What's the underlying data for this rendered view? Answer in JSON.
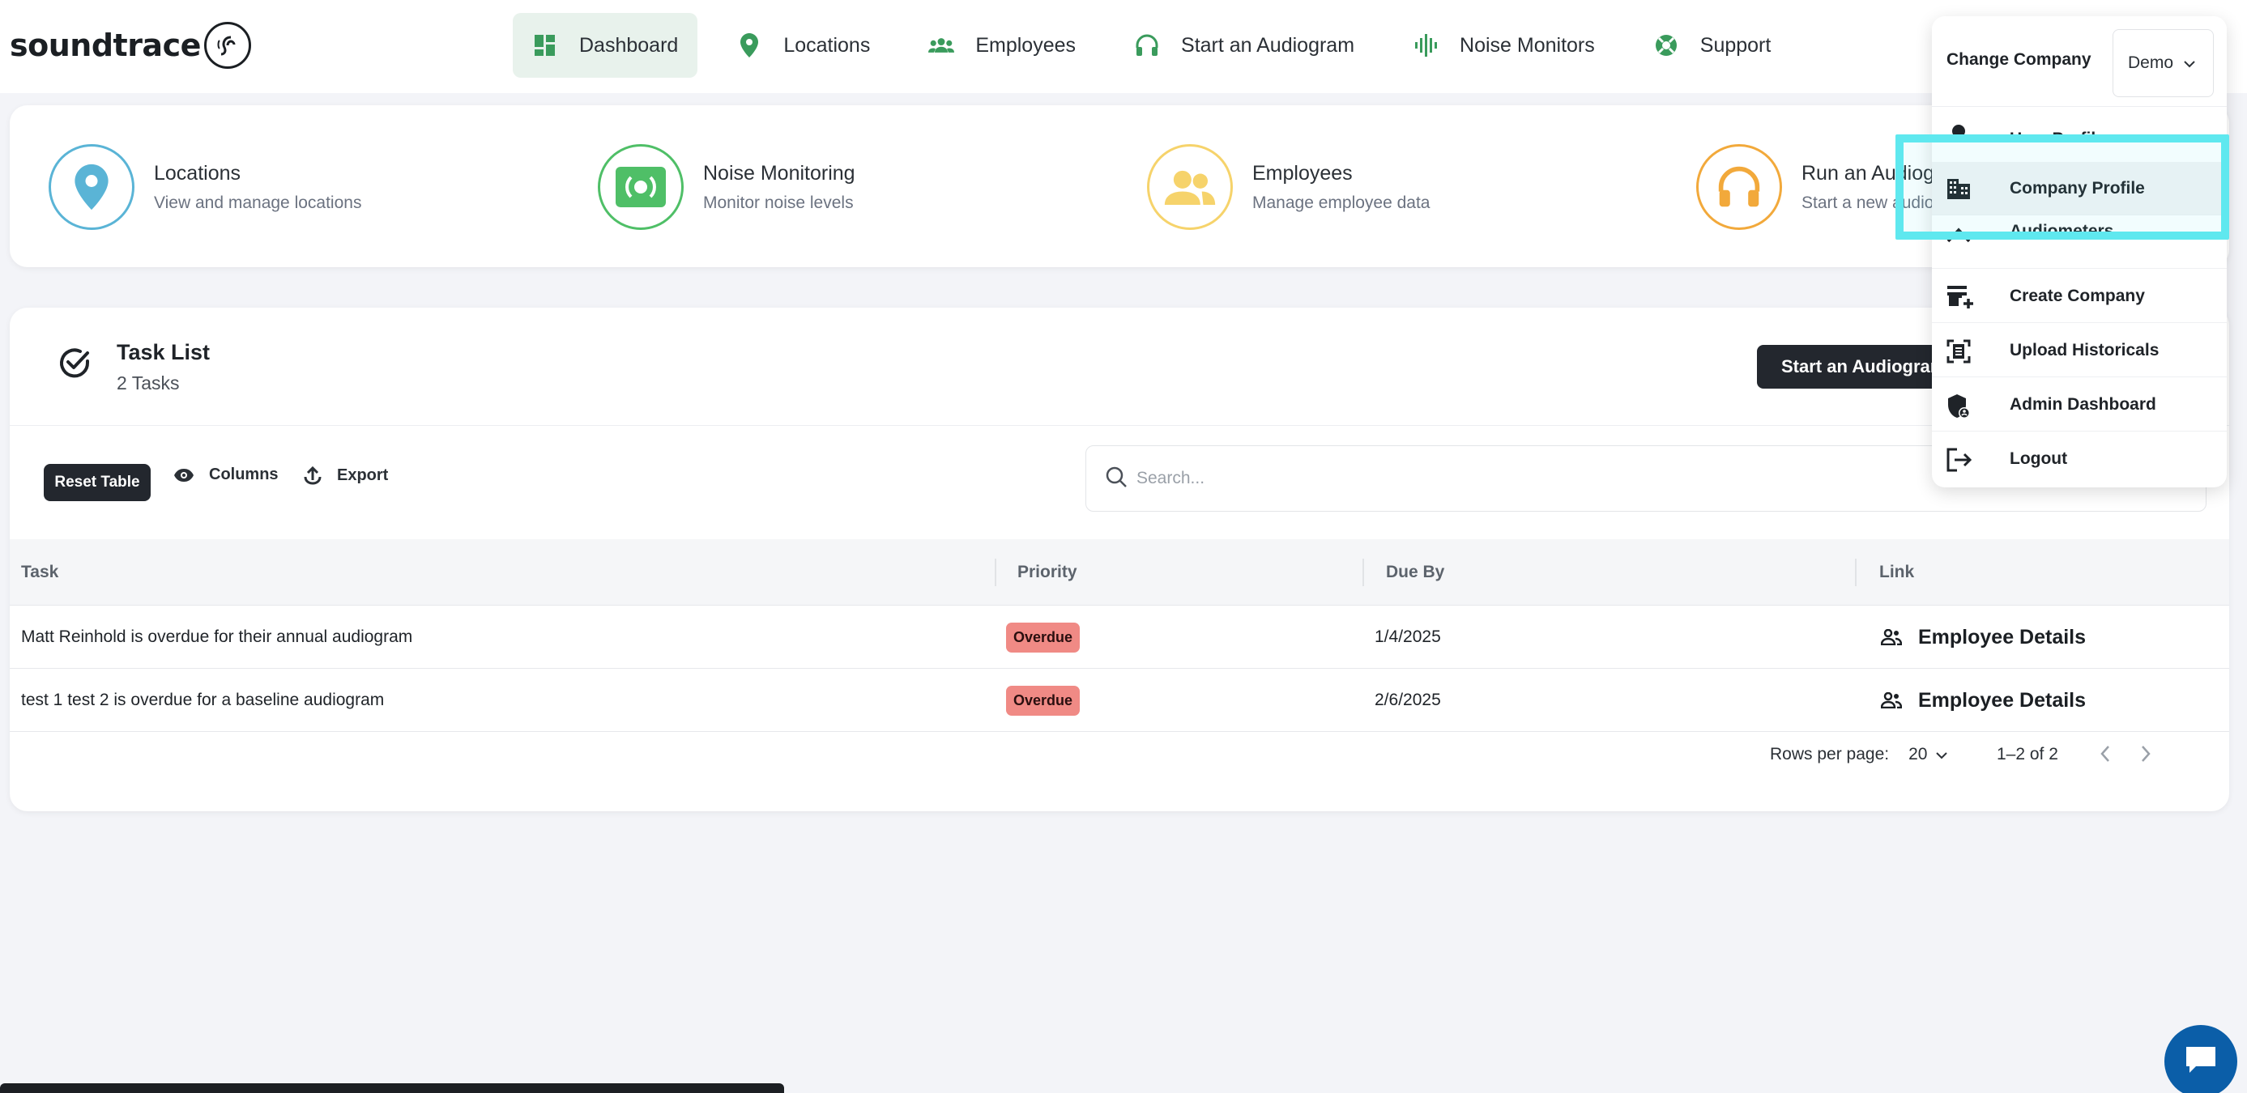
{
  "app": {
    "brand": "soundtrace"
  },
  "nav": [
    {
      "label": "Dashboard",
      "icon": "dashboard-icon",
      "active": true
    },
    {
      "label": "Locations",
      "icon": "location-pin-icon"
    },
    {
      "label": "Employees",
      "icon": "people-icon"
    },
    {
      "label": "Start an Audiogram",
      "icon": "headphones-icon"
    },
    {
      "label": "Noise Monitors",
      "icon": "sound-wave-icon"
    },
    {
      "label": "Support",
      "icon": "lifebuoy-icon"
    }
  ],
  "quick_actions": [
    {
      "title": "Locations",
      "subtitle": "View and manage locations",
      "icon": "location-pin-icon",
      "color": "#5ab4d6"
    },
    {
      "title": "Noise Monitoring",
      "subtitle": "Monitor noise levels",
      "icon": "noise-monitor-icon",
      "color": "#4fbf67"
    },
    {
      "title": "Employees",
      "subtitle": "Manage employee data",
      "icon": "people-icon",
      "color": "#f6d36b"
    },
    {
      "title": "Run an Audiogr",
      "subtitle": "Start a new audio",
      "icon": "headphones-icon",
      "color": "#f2a93b"
    }
  ],
  "tasks": {
    "title": "Task List",
    "count": "2 Tasks",
    "start_button": "Start an Audiogram",
    "toolbar": {
      "reset": "Reset Table",
      "columns": "Columns",
      "export": "Export"
    },
    "search_placeholder": "Search...",
    "columns": [
      "Task",
      "Priority",
      "Due By",
      "Link"
    ],
    "rows": [
      {
        "task": "Matt Reinhold is overdue for their annual audiogram",
        "priority": "Overdue",
        "due": "1/4/2025",
        "link": "Employee Details"
      },
      {
        "task": "test 1 test 2 is overdue for a baseline audiogram",
        "priority": "Overdue",
        "due": "2/6/2025",
        "link": "Employee Details"
      }
    ],
    "pagination": {
      "rows_label": "Rows per page:",
      "rows_value": "20",
      "range": "1–2 of 2"
    }
  },
  "menu": {
    "change_label": "Change Company",
    "company": "Demo",
    "items": [
      {
        "label": "User Profile",
        "icon": "user-icon"
      },
      {
        "label": "Company Profile",
        "icon": "building-icon"
      },
      {
        "label": "Audiometers",
        "icon": "audiometer-icon"
      },
      {
        "label": "Create Company",
        "icon": "add-store-icon"
      },
      {
        "label": "Upload Historicals",
        "icon": "document-scan-icon"
      },
      {
        "label": "Admin Dashboard",
        "icon": "admin-shield-icon"
      },
      {
        "label": "Logout",
        "icon": "logout-icon"
      }
    ]
  },
  "colors": {
    "highlight": "#5fe8ef",
    "nav_green": "#3a9b5c",
    "overdue": "#f08a85"
  }
}
